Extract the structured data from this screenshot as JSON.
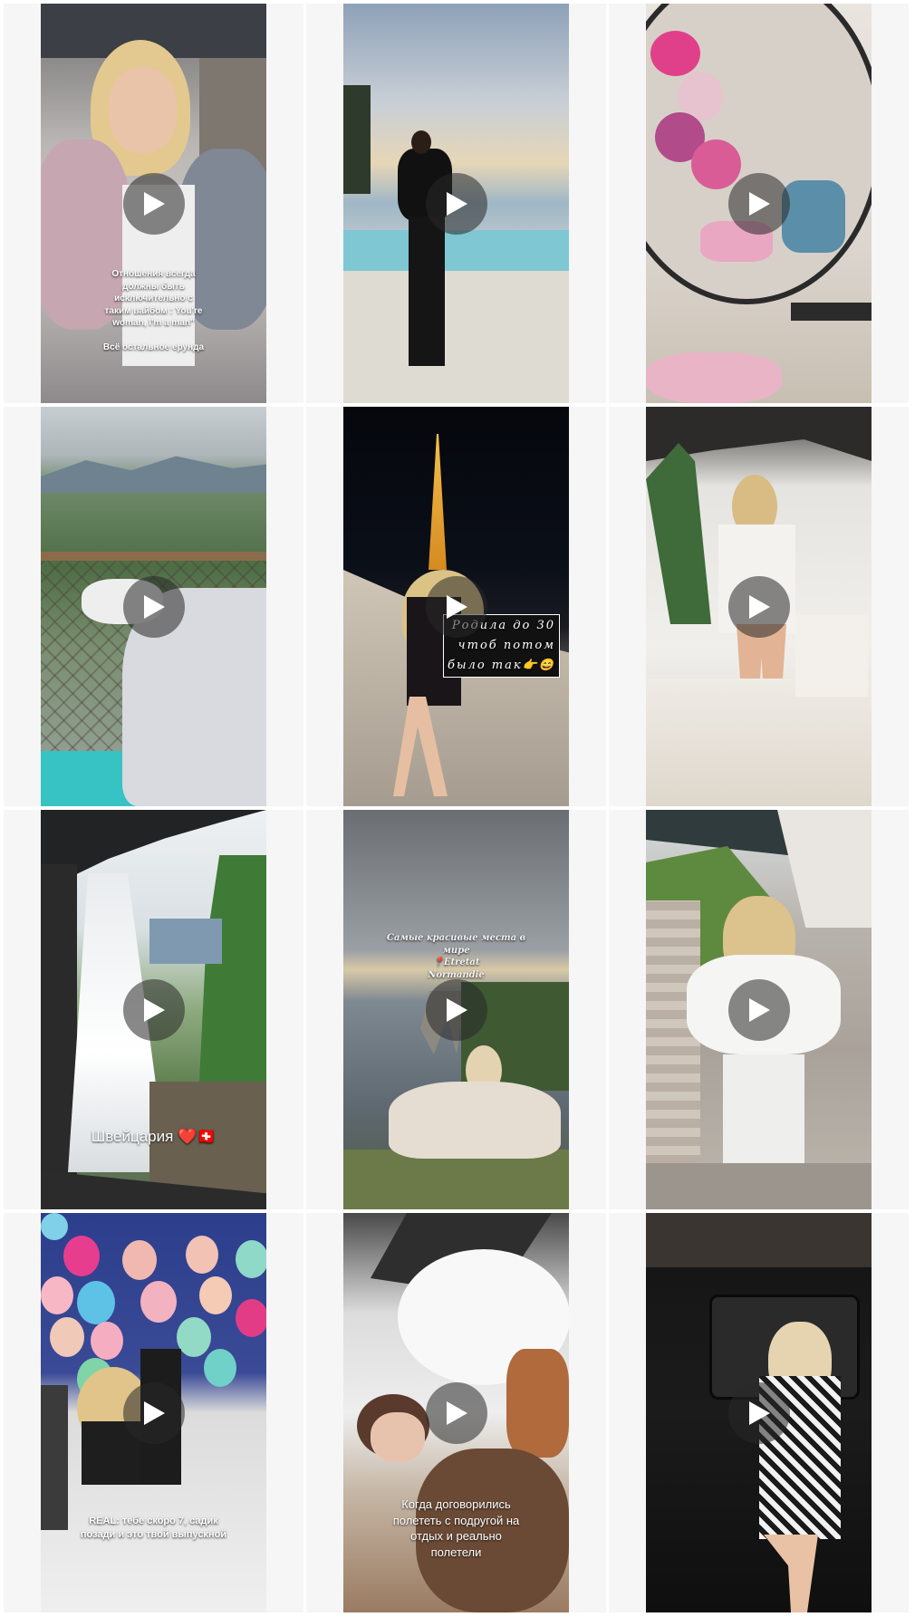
{
  "grid": {
    "items": [
      {
        "caption": "Отношения всегда\nдолжны быть\nисключительно с\nтаким вайбом : You're\nwoman, I'm a man\"\n\nВсё остальное ерунда"
      },
      {
        "caption": ""
      },
      {
        "caption": ""
      },
      {
        "caption": ""
      },
      {
        "caption": "Родила до 30\nчтоб потом\nбыло так👉😄"
      },
      {
        "caption": ""
      },
      {
        "caption": "Швейцария ❤️🇨🇭"
      },
      {
        "caption": "Самые красивые места в\nмире\n📍Etretat\nNormandie"
      },
      {
        "caption": ""
      },
      {
        "caption": "REAL: тебе скоро 7, садик\nпозади и это твой выпускной"
      },
      {
        "caption": "Когда договорились\nполететь с подругой на\nотдых и реально\nполетели"
      },
      {
        "caption": ""
      }
    ]
  }
}
